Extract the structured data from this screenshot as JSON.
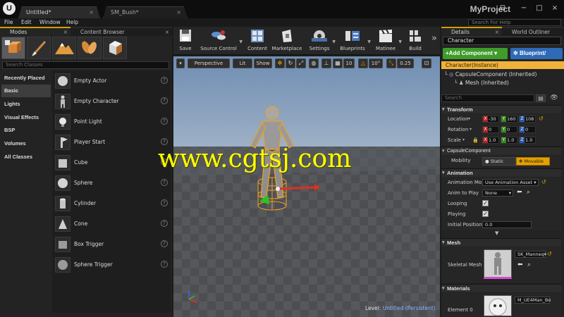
{
  "window": {
    "tabs": [
      {
        "label": "Untitled*",
        "close": "×"
      },
      {
        "label": "SM_Bush*",
        "close": "×"
      }
    ],
    "logo": "U",
    "project_name": "MyProject",
    "controls": [
      "⊟",
      "−",
      "□",
      "×"
    ]
  },
  "menu": {
    "items": [
      "File",
      "Edit",
      "Window",
      "Help"
    ],
    "search_placeholder": "Search For Help"
  },
  "modes": {
    "tab_modes": "Modes",
    "tab_content": "Content Browser",
    "search_placeholder": "Search Classes",
    "mode_icons": [
      "place-icon",
      "paint-icon",
      "landscape-icon",
      "foliage-icon",
      "geometry-icon"
    ],
    "categories": [
      "Recently Placed",
      "Basic",
      "Lights",
      "Visual Effects",
      "BSP",
      "Volumes",
      "All Classes"
    ],
    "selected_category": "Basic",
    "items": [
      "Empty Actor",
      "Empty Character",
      "Point Light",
      "Player Start",
      "Cube",
      "Sphere",
      "Cylinder",
      "Cone",
      "Box Trigger",
      "Sphere Trigger"
    ],
    "help": "?"
  },
  "toolbar": {
    "buttons": [
      "Save",
      "Source Control",
      "Content",
      "Marketplace",
      "Settings",
      "Blueprints",
      "Matinee",
      "Build"
    ],
    "more": "»"
  },
  "viewport": {
    "perspective": "Perspective",
    "lit": "Lit",
    "show": "Show",
    "grid_snap": "10",
    "rot_snap": "10°",
    "scale_snap": "0.25",
    "level_label": "Level:",
    "level_name": "Untitled (Persistent)",
    "watermark": "www.cgtsj.com",
    "colors": {
      "sky": "#7d98b8",
      "floor": "#4a4c50",
      "selection": "#f0a020"
    }
  },
  "details": {
    "tab_details": "Details",
    "tab_outliner": "World Outliner",
    "actor_name": "Character",
    "add_component": "+Add Component",
    "blueprint": "Blueprint/",
    "instance": "Character(Instance)",
    "components": [
      "CapsuleComponent (Inherited)",
      "Mesh (Inherited)"
    ],
    "search_placeholder": "Search",
    "transform": {
      "header": "Transform",
      "location_label": "Location",
      "location": [
        "-30",
        "160",
        "108"
      ],
      "rotation_label": "Rotation",
      "rotation": [
        "0",
        "0",
        "0"
      ],
      "scale_label": "Scale",
      "scale": [
        "1.0",
        "1.0",
        "1.0"
      ]
    },
    "capsule": {
      "header": "CapsuleComponent",
      "mobility_label": "Mobility",
      "static": "Static",
      "movable": "Movable"
    },
    "animation": {
      "header": "Animation",
      "mode_label": "Animation Mo",
      "mode_value": "Use Animation Asset",
      "anim_label": "Anim to Play",
      "anim_value": "None",
      "looping_label": "Looping",
      "looping": true,
      "playing_label": "Playing",
      "playing": true,
      "initpos_label": "Initial Position",
      "initpos_value": "0.0"
    },
    "mesh": {
      "header": "Mesh",
      "skel_label": "Skeletal Mesh",
      "skel_value": "SK_Manneq"
    },
    "materials": {
      "header": "Materials",
      "elem_label": "Element 0",
      "elem_value": "M_UE4Man_Bo"
    }
  }
}
